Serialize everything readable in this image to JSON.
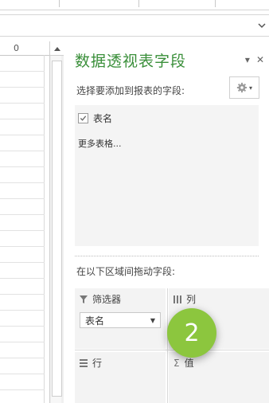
{
  "sheet": {
    "column_header": "0"
  },
  "pane": {
    "title": "数据透视表字段",
    "pin_glyph": "▾",
    "close_glyph": "✕",
    "choose_label": "选择要添加到报表的字段:",
    "fields": [
      {
        "label": "表名",
        "checked": true
      }
    ],
    "more_tables": "更多表格...",
    "drag_label": "在以下区域间拖动字段:",
    "areas": {
      "filters": {
        "label": "筛选器",
        "pill": "表名"
      },
      "columns": {
        "label": "列"
      },
      "rows": {
        "label": "行"
      },
      "values": {
        "label": "值"
      }
    }
  },
  "badge": {
    "text": "2",
    "color": "#8cc63e"
  },
  "colors": {
    "title_green": "#3a8f3a"
  }
}
